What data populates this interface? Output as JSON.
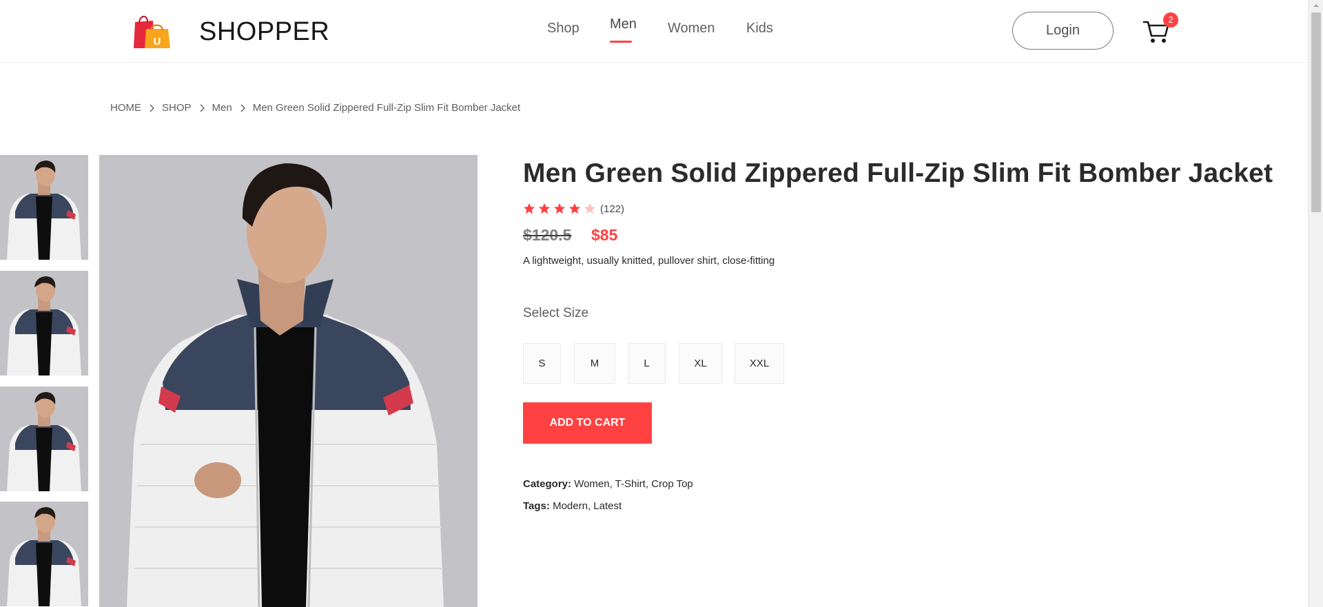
{
  "brand": {
    "name": "SHOPPER",
    "logo_letter": "U"
  },
  "nav": {
    "items": [
      {
        "label": "Shop",
        "active": false
      },
      {
        "label": "Men",
        "active": true
      },
      {
        "label": "Women",
        "active": false
      },
      {
        "label": "Kids",
        "active": false
      }
    ]
  },
  "header": {
    "login_label": "Login",
    "cart_count": "2"
  },
  "breadcrumb": [
    "HOME",
    "SHOP",
    "Men",
    "Men Green Solid Zippered Full-Zip Slim Fit Bomber Jacket"
  ],
  "product": {
    "title": "Men Green Solid Zippered Full-Zip Slim Fit Bomber Jacket",
    "rating": 4,
    "rating_max": 5,
    "review_count": "(122)",
    "old_price": "$120.5",
    "new_price": "$85",
    "description": "A lightweight, usually knitted, pullover shirt, close-fitting",
    "size_label": "Select Size",
    "sizes": [
      "S",
      "M",
      "L",
      "XL",
      "XXL"
    ],
    "add_to_cart_label": "ADD TO CART",
    "category_label": "Category:",
    "category_value": "Women, T-Shirt, Crop Top",
    "tags_label": "Tags:",
    "tags_value": "Modern, Latest"
  },
  "colors": {
    "accent": "#ff4141",
    "text_dark": "#171717",
    "image_bg": "#c3c3c7"
  },
  "icons": {
    "logo": "shopping-bag-icon",
    "cart": "cart-icon",
    "breadcrumb_separator": "chevron-right-icon",
    "rating": "star-icon"
  }
}
